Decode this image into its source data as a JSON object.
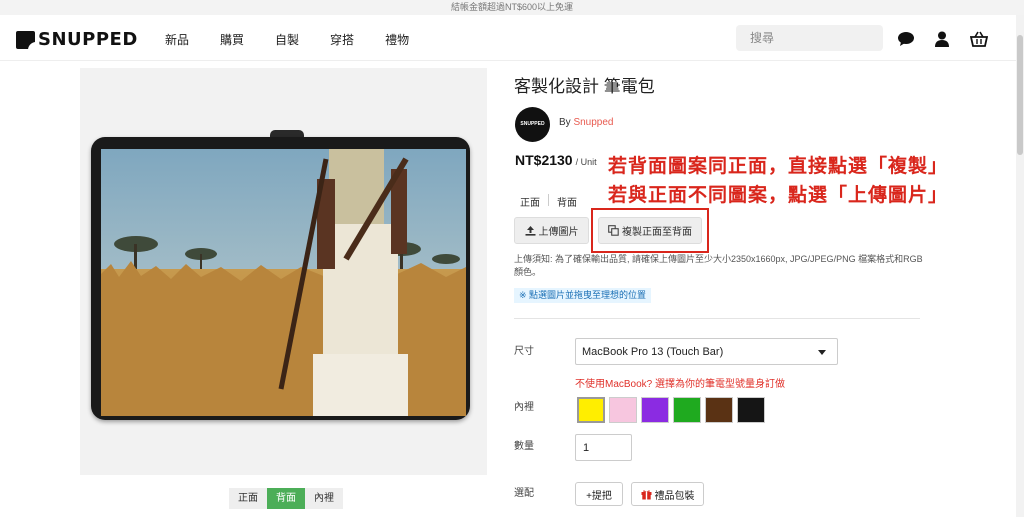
{
  "topbar": {
    "shipping_notice": "結帳金額超過NT$600以上免運"
  },
  "header": {
    "logo_text": "SNUPPED",
    "nav": [
      "新品",
      "購買",
      "自製",
      "穿搭",
      "禮物"
    ],
    "search_placeholder": "搜尋",
    "icons": [
      "chat-icon",
      "user-icon",
      "cart-icon"
    ]
  },
  "preview": {
    "view_tabs": [
      "正面",
      "背面",
      "內裡"
    ],
    "active_tab": "背面"
  },
  "product": {
    "title": "客製化設計 筆電包",
    "avatar_text": "SNUPPED",
    "by_label": "By",
    "brand": "Snupped",
    "price": "NT$2130",
    "unit": "/ Unit",
    "side_tabs": [
      "正面",
      "背面"
    ],
    "upload_button": "上傳圖片",
    "copy_button": "複製正面至背面",
    "upload_note": "上傳須知: 為了確保輸出品質, 請確保上傳圖片至少大小2350x1660px, JPG/JPEG/PNG 檔案格式和RGB顏色。",
    "hint": "※ 點選圖片並拖曳至理想的位置",
    "size_label": "尺寸",
    "size_value": "MacBook Pro 13 (Touch Bar)",
    "size_warning": "不使用MacBook? 選擇為你的筆電型號量身訂做",
    "lining_label": "內裡",
    "lining_colors": [
      "#ffee00",
      "#f7c6df",
      "#8b2be2",
      "#1faa1f",
      "#5a3214",
      "#151515"
    ],
    "qty_label": "數量",
    "qty_value": "1",
    "options_label": "選配",
    "option_handle": "+提把",
    "option_gift": "禮品包裝"
  },
  "annotation": {
    "line1": "若背面圖案同正面，直接點選「複製」",
    "line2": "若與正面不同圖案，點選「上傳圖片」"
  }
}
